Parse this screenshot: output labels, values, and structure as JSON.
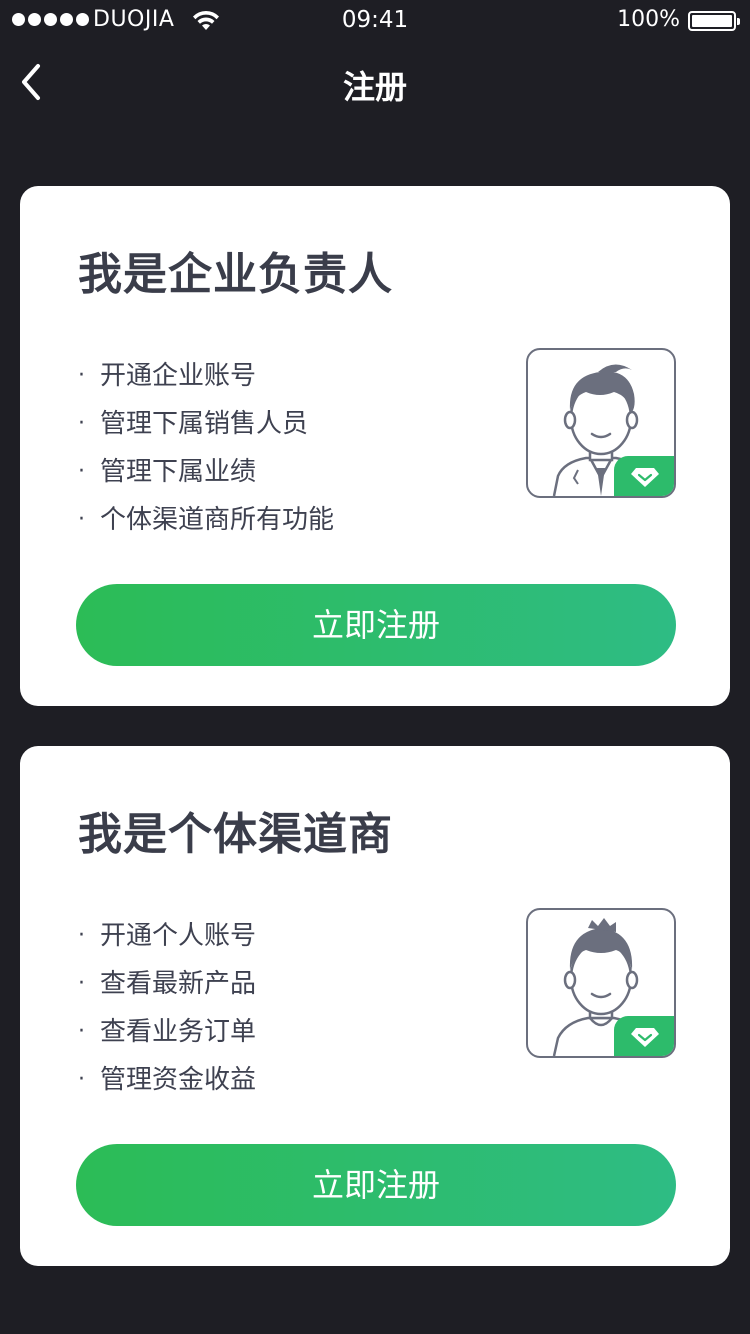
{
  "status_bar": {
    "carrier": "DUOJIA",
    "time": "09:41",
    "battery": "100%"
  },
  "nav": {
    "title": "注册",
    "back_icon": "chevron-left-icon"
  },
  "cards": [
    {
      "title": "我是企业负责人",
      "features": [
        "开通企业账号",
        "管理下属销售人员",
        "管理下属业绩",
        "个体渠道商所有功能"
      ],
      "bullet": "·",
      "avatar_icon": "businessman-avatar-icon",
      "badge_icon": "diamond-icon",
      "button_label": "立即注册"
    },
    {
      "title": "我是个体渠道商",
      "features": [
        "开通个人账号",
        "查看最新产品",
        "查看业务订单",
        "管理资金收益"
      ],
      "bullet": "·",
      "avatar_icon": "person-avatar-icon",
      "badge_icon": "diamond-icon",
      "button_label": "立即注册"
    }
  ],
  "colors": {
    "background": "#1e1e24",
    "card": "#ffffff",
    "accent_start": "#2cbc56",
    "accent_end": "#2ebc84",
    "title_text": "#3a3d4a"
  }
}
